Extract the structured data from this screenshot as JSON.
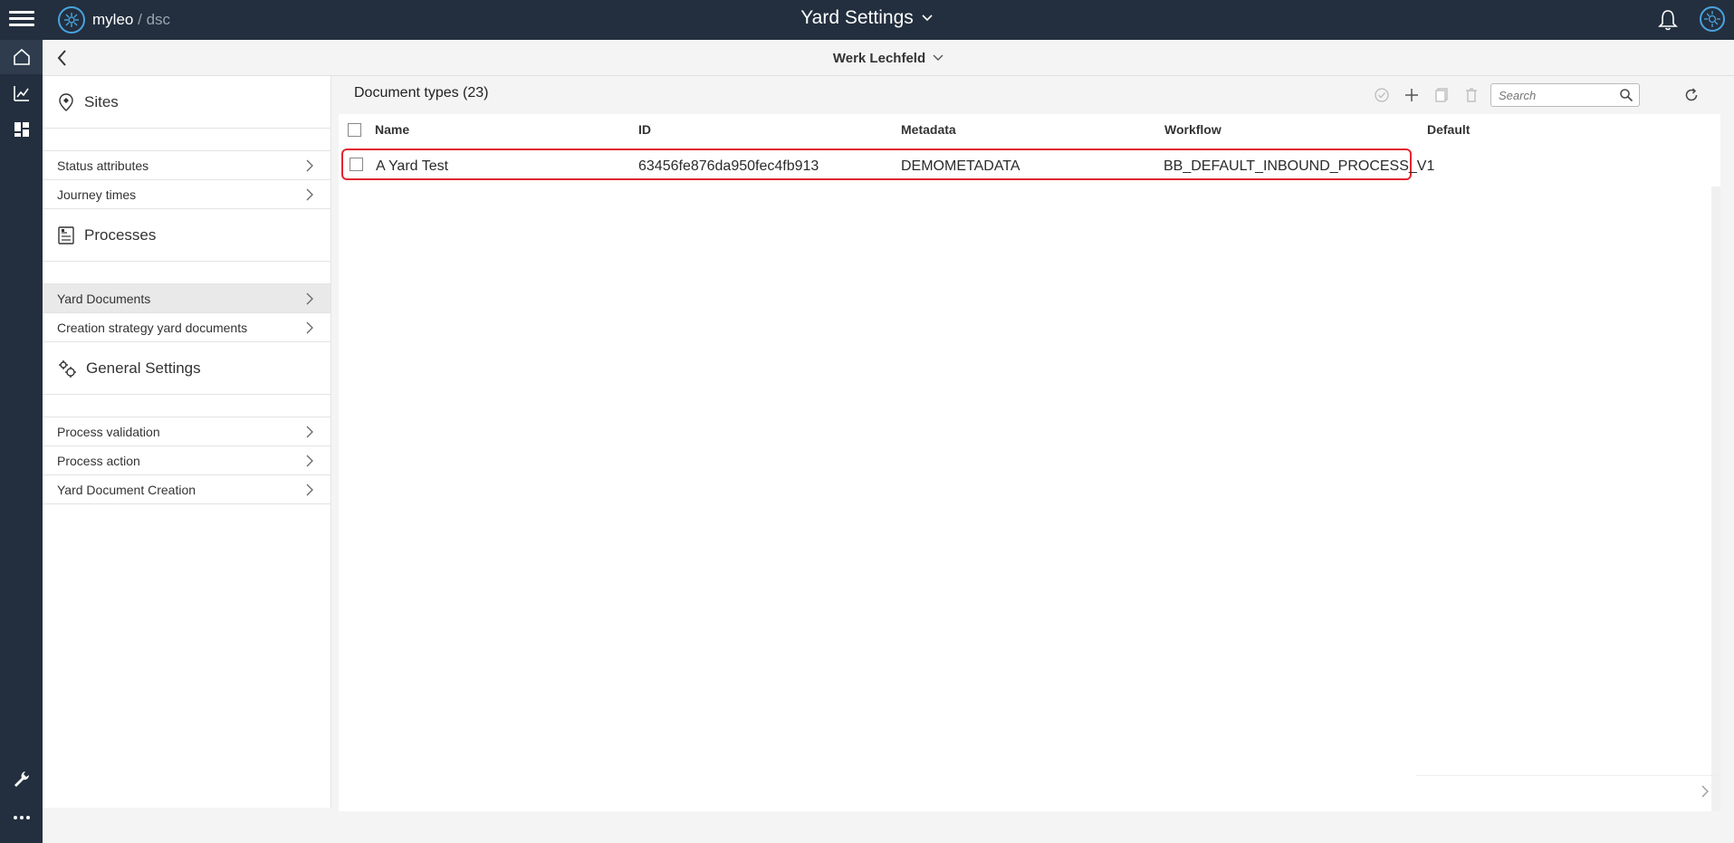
{
  "topbar": {
    "brand_name": "myleo",
    "brand_separator": "/",
    "brand_sub": "dsc",
    "title": "Yard Settings",
    "icons": [
      "menu-icon",
      "brand-logo",
      "chevron-down-icon",
      "bell-icon",
      "user-avatar-logo"
    ]
  },
  "rail": {
    "icons": [
      "home-icon",
      "analytics-icon",
      "dashboard-icon",
      "wrench-icon",
      "more-icon"
    ]
  },
  "subheader": {
    "site": "Werk Lechfeld"
  },
  "sidebar": {
    "sections": [
      {
        "title": "Sites",
        "icon": "location-pin-icon",
        "items": [
          {
            "label": "Status attributes"
          },
          {
            "label": "Journey times"
          }
        ]
      },
      {
        "title": "Processes",
        "icon": "document-icon",
        "items": [
          {
            "label": "Yard Documents",
            "selected": true
          },
          {
            "label": "Creation strategy yard documents"
          }
        ]
      },
      {
        "title": "General Settings",
        "icon": "gears-icon",
        "items": [
          {
            "label": "Process validation"
          },
          {
            "label": "Process action"
          },
          {
            "label": "Yard Document Creation"
          }
        ]
      }
    ]
  },
  "main": {
    "title": "Document types (23)",
    "search_placeholder": "Search",
    "toolbar_icons": [
      "check-circle-icon",
      "plus-icon",
      "copy-icon",
      "trash-icon",
      "search-icon",
      "refresh-icon"
    ],
    "columns": [
      "Name",
      "ID",
      "Metadata",
      "Workflow",
      "Default"
    ],
    "rows": [
      {
        "name": "A Yard Test",
        "id": "63456fe876da950fec4fb913",
        "metadata": "DEMOMETADATA",
        "workflow": "BB_DEFAULT_INBOUND_PROCESS_V1",
        "default": ""
      }
    ]
  },
  "colors": {
    "topbar_bg": "#232f3e",
    "highlight_border": "#e0262f",
    "accent": "#1fa2c8"
  }
}
